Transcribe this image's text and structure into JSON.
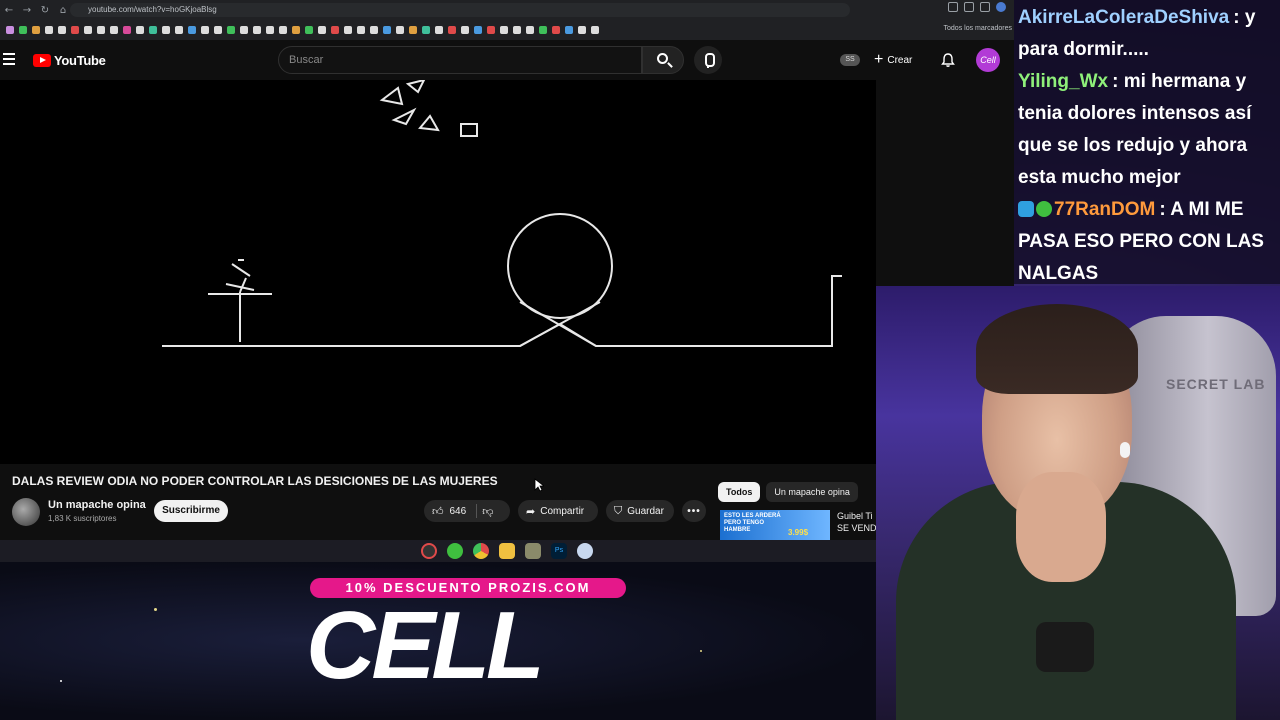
{
  "browser": {
    "url": "youtube.com/watch?v=hoGKjoaBlsg",
    "bookmarks_folder": "Todos los marcadores"
  },
  "youtube": {
    "logo_text": "YouTube",
    "search_placeholder": "Buscar",
    "ss_badge": "SS",
    "create_label": "Crear",
    "avatar_text": "Cell"
  },
  "video": {
    "title": "DALAS REVIEW ODIA NO PODER CONTROLAR LAS DESICIONES DE LAS MUJERES",
    "channel_name": "Un mapache opina",
    "subscribers": "1,83 K suscriptores",
    "subscribe_label": "Suscribirme",
    "likes": "646",
    "share_label": "Compartir",
    "save_label": "Guardar"
  },
  "recommendations": {
    "chips": [
      "Todos",
      "Un mapache opina"
    ],
    "item": {
      "thumb_text": "ESTO LES ARDERÁ PERO TENGO HAMBRE",
      "thumb_price": "3.99$",
      "title_line1": "Guibel Ti",
      "title_line2": "SE VEND"
    }
  },
  "taskbar": {
    "icons": [
      "recorder-icon",
      "xbox-icon",
      "chrome-icon",
      "files-icon",
      "app-icon",
      "photoshop-icon",
      "discord-icon"
    ],
    "ps_label": "Ps"
  },
  "ad": {
    "promo_text": "10% DESCUENTO PROZIS.COM",
    "logo_text": "CELL"
  },
  "chat": {
    "messages": [
      {
        "user": "AkirreLaColeraDeShiva",
        "user_color": "#9fd0ff",
        "text": ": y para dormir....."
      },
      {
        "user": "Yiling_Wx",
        "user_color": "#8ff07a",
        "text": ": mi hermana y tenia dolores intensos así que se los redujo y ahora esta mucho mejor"
      },
      {
        "user": "77RanDOM",
        "user_color": "#ff9a3c",
        "text": ": A MI ME PASA ESO PERO CON LAS NALGAS"
      }
    ]
  },
  "webcam": {
    "chair_text": "SECRET LAB"
  }
}
